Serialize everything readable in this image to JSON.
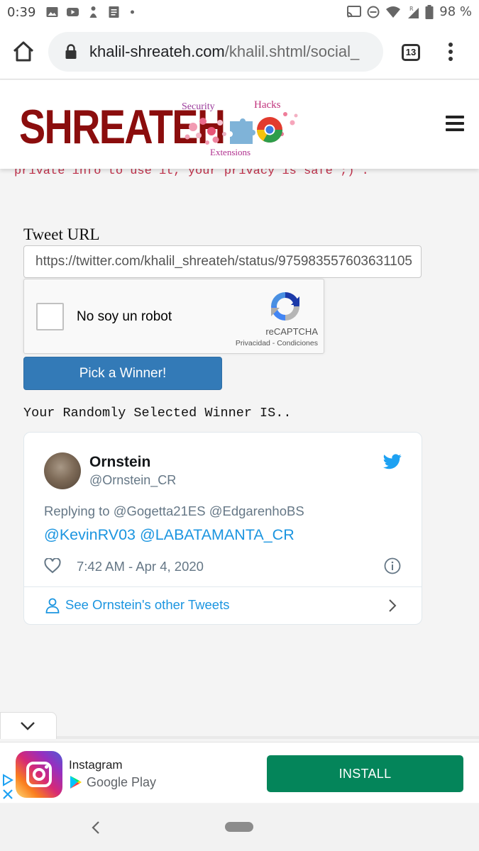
{
  "status_bar": {
    "time": "0:39",
    "battery": "98 %"
  },
  "browser": {
    "url_host": "khalil-shreateh.com",
    "url_path": "/khalil.shtml/social_",
    "tab_count": "13"
  },
  "site": {
    "logo_text": "SHREATEH",
    "logo_tags": [
      "Security",
      "Hacks",
      "Extensions"
    ],
    "privacy_notice": "private info to use it, your privacy is safe ;) ."
  },
  "form": {
    "tweet_url_label": "Tweet URL",
    "tweet_url_value": "https://twitter.com/khalil_shreateh/status/975983557603631105",
    "captcha_label": "No soy un robot",
    "captcha_brand": "reCAPTCHA",
    "captcha_links": "Privacidad - Condiciones",
    "pick_button": "Pick a Winner!"
  },
  "result": {
    "heading": "Your Randomly Selected Winner IS.."
  },
  "tweet": {
    "name": "Ornstein",
    "handle": "@Ornstein_CR",
    "replying_to": "Replying to @Gogetta21ES @EdgarenhoBS",
    "mentions": "@KevinRV03 @LABATAMANTA_CR",
    "timestamp": "7:42 AM - Apr 4, 2020",
    "other_tweets": "See Ornstein's other Tweets"
  },
  "ad": {
    "app_name": "Instagram",
    "store": "Google Play",
    "install_label": "INSTALL"
  },
  "colors": {
    "logo_red": "#8b0d0d",
    "button_blue": "#337ab7",
    "twitter_blue": "#1b95e0",
    "install_green": "#04855a",
    "notice_pink": "#c0304a"
  }
}
